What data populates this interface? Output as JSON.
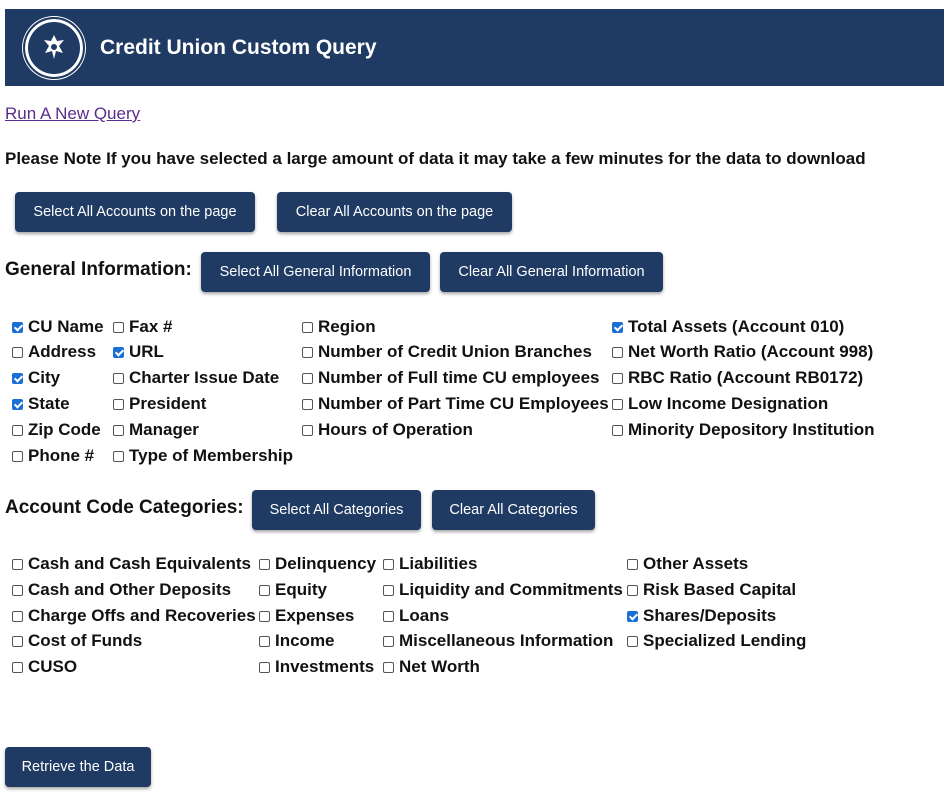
{
  "header": {
    "title": "Credit Union Custom Query",
    "logo_icon": "ncua-seal-icon"
  },
  "run_link": "Run A New Query",
  "note": "Please Note If you have selected a large amount of data it may take a few minutes for the data to download",
  "accounts": {
    "select_all": "Select All Accounts on the page",
    "clear_all": "Clear All Accounts on the page"
  },
  "general": {
    "title": "General Information:",
    "select_all": "Select All General Information",
    "clear_all": "Clear All General Information",
    "items": [
      {
        "label": "CU Name",
        "checked": true
      },
      {
        "label": "Address",
        "checked": false
      },
      {
        "label": "City",
        "checked": true
      },
      {
        "label": "State",
        "checked": true
      },
      {
        "label": "Zip Code",
        "checked": false
      },
      {
        "label": "Phone #",
        "checked": false
      },
      {
        "label": "Fax #",
        "checked": false
      },
      {
        "label": "URL",
        "checked": true
      },
      {
        "label": "Charter Issue Date",
        "checked": false
      },
      {
        "label": "President",
        "checked": false
      },
      {
        "label": "Manager",
        "checked": false
      },
      {
        "label": "Type of Membership",
        "checked": false
      },
      {
        "label": "Region",
        "checked": false
      },
      {
        "label": "Number of Credit Union Branches",
        "checked": false
      },
      {
        "label": "Number of Full time CU employees",
        "checked": false
      },
      {
        "label": "Number of Part Time CU Employees",
        "checked": false
      },
      {
        "label": "Hours of Operation",
        "checked": false
      },
      {
        "label": "Total Assets (Account 010)",
        "checked": true
      },
      {
        "label": "Net Worth Ratio (Account 998)",
        "checked": false
      },
      {
        "label": "RBC Ratio (Account RB0172)",
        "checked": false
      },
      {
        "label": "Low Income Designation",
        "checked": false
      },
      {
        "label": "Minority Depository Institution",
        "checked": false
      }
    ]
  },
  "categories": {
    "title": "Account Code Categories:",
    "select_all": "Select All Categories",
    "clear_all": "Clear All Categories",
    "items": [
      {
        "label": "Cash and Cash Equivalents",
        "checked": false
      },
      {
        "label": "Cash and Other Deposits",
        "checked": false
      },
      {
        "label": "Charge Offs and Recoveries",
        "checked": false
      },
      {
        "label": "Cost of Funds",
        "checked": false
      },
      {
        "label": "CUSO",
        "checked": false
      },
      {
        "label": "Delinquency",
        "checked": false
      },
      {
        "label": "Equity",
        "checked": false
      },
      {
        "label": "Expenses",
        "checked": false
      },
      {
        "label": "Income",
        "checked": false
      },
      {
        "label": "Investments",
        "checked": false
      },
      {
        "label": "Liabilities",
        "checked": false
      },
      {
        "label": "Liquidity and Commitments",
        "checked": false
      },
      {
        "label": "Loans",
        "checked": false
      },
      {
        "label": "Miscellaneous Information",
        "checked": false
      },
      {
        "label": "Net Worth",
        "checked": false
      },
      {
        "label": "Other Assets",
        "checked": false
      },
      {
        "label": "Risk Based Capital",
        "checked": false
      },
      {
        "label": "Shares/Deposits",
        "checked": true
      },
      {
        "label": "Specialized Lending",
        "checked": false
      }
    ]
  },
  "retrieve_button": "Retrieve the Data",
  "colors": {
    "header_bg": "#1f3a63",
    "button_bg": "#1f3a63",
    "checkbox_checked": "#1a6fd6",
    "link": "#5a2d8c"
  }
}
